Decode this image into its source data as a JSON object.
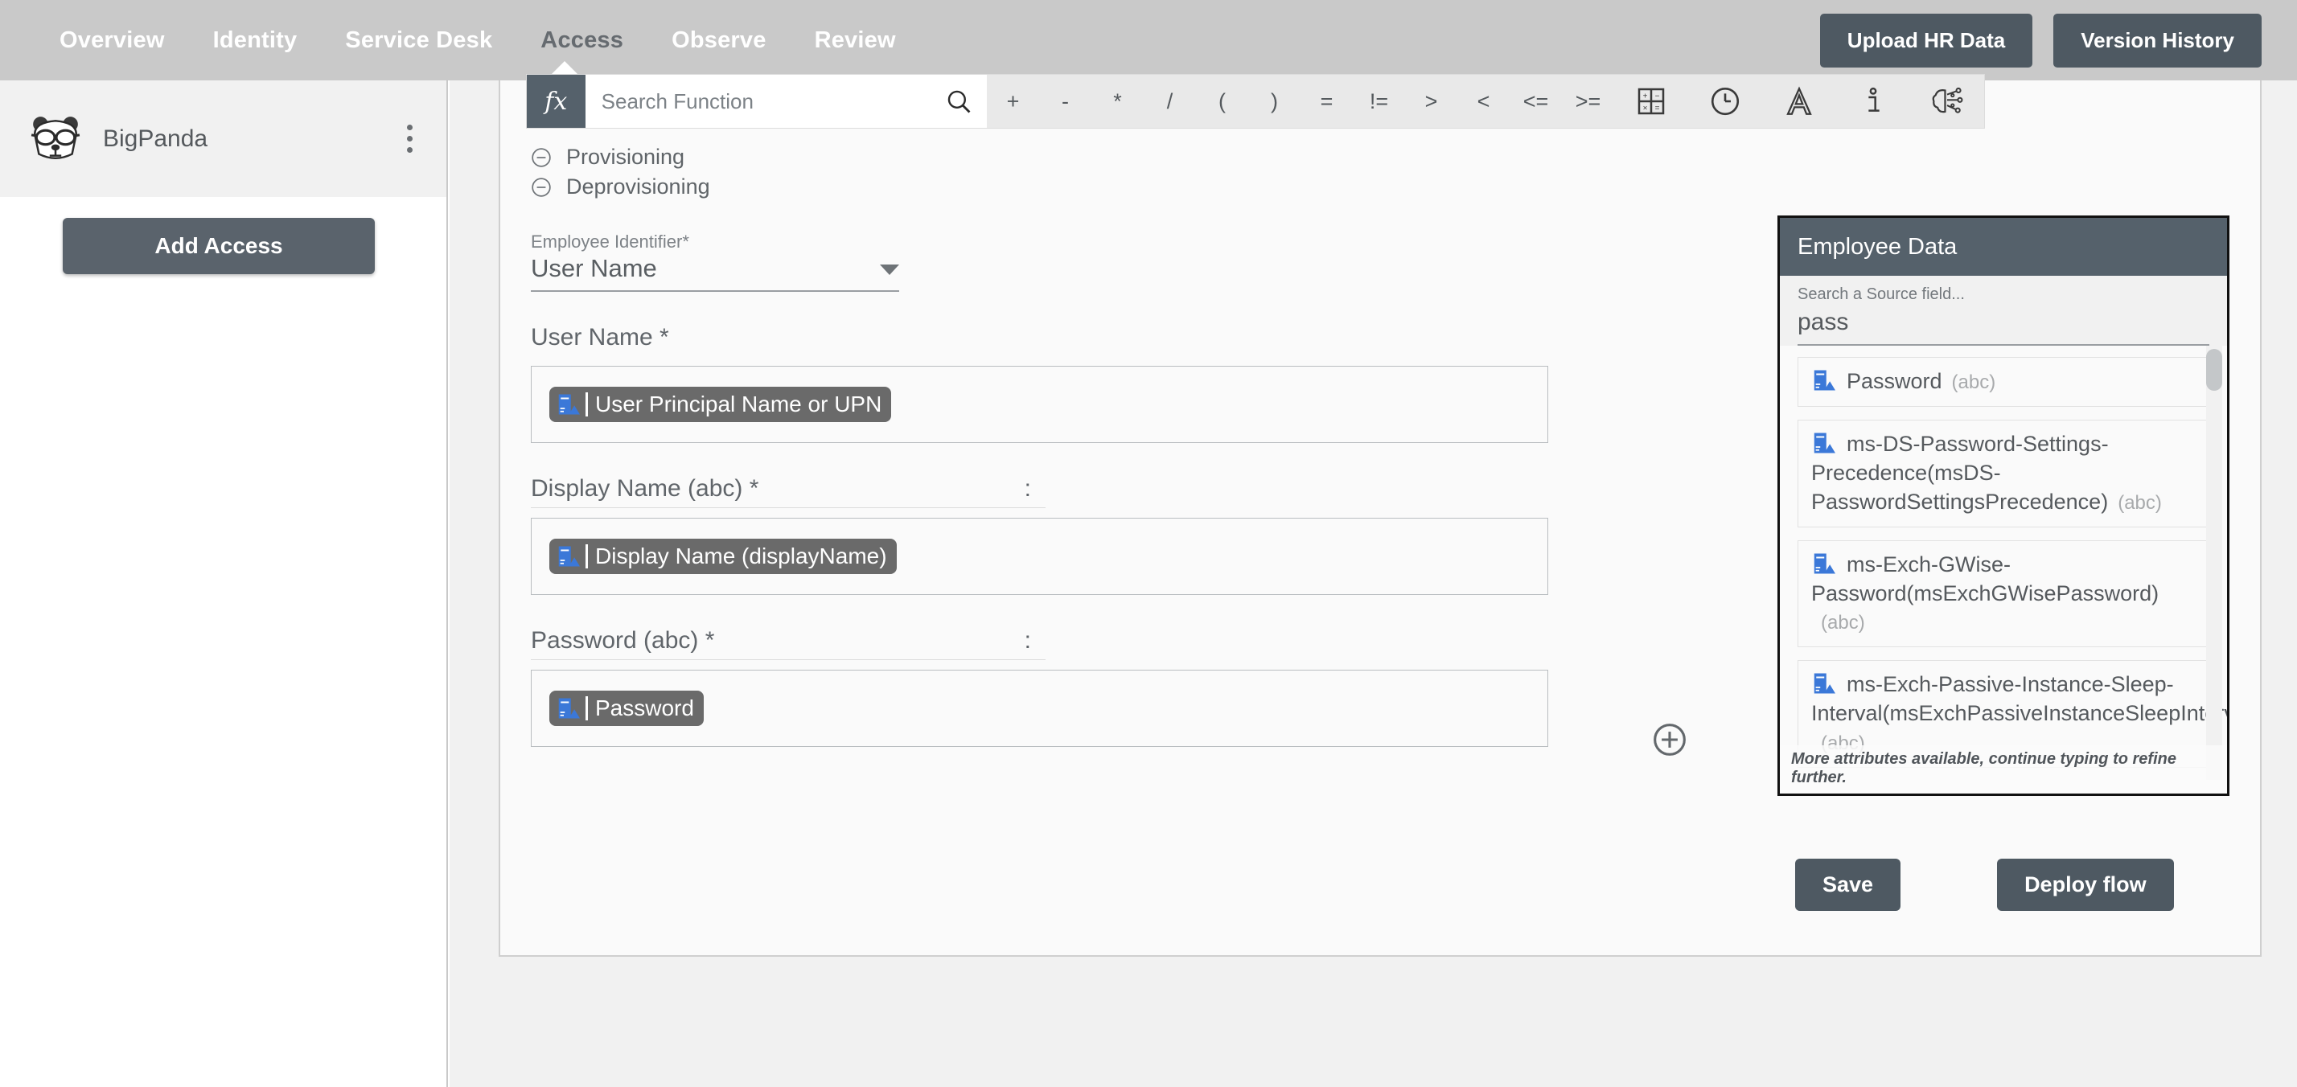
{
  "topnav": {
    "items": [
      {
        "label": "Overview",
        "active": false
      },
      {
        "label": "Identity",
        "active": false
      },
      {
        "label": "Service Desk",
        "active": false
      },
      {
        "label": "Access",
        "active": true
      },
      {
        "label": "Observe",
        "active": false
      },
      {
        "label": "Review",
        "active": false
      }
    ],
    "upload_hr_data": "Upload HR Data",
    "version_history": "Version History",
    "bg_color": "#c9c9c9",
    "button_color": "#4e5962"
  },
  "sidebar": {
    "org_name": "BigPanda",
    "logo_icon": "panda-logo-icon",
    "menu_icon": "kebab-menu-icon",
    "add_access": "Add Access"
  },
  "formula_bar": {
    "fx_label": "fx",
    "search_placeholder": "Search Function",
    "search_value": "",
    "search_icon": "search-icon",
    "operators": [
      "+",
      "-",
      "*",
      "/",
      "(",
      ")",
      "=",
      "!=",
      ">",
      "<",
      "<=",
      ">="
    ],
    "icons": [
      {
        "name": "calculator-icon",
        "title": "Math"
      },
      {
        "name": "clock-icon",
        "title": "Date & Time"
      },
      {
        "name": "text-a-icon",
        "title": "Text"
      },
      {
        "name": "info-icon",
        "title": "Info"
      },
      {
        "name": "ai-brain-icon",
        "title": "AI"
      }
    ]
  },
  "form": {
    "sections": [
      {
        "label": "Provisioning",
        "icon": "minus-circle-icon"
      },
      {
        "label": "Deprovisioning",
        "icon": "minus-circle-icon"
      }
    ],
    "employee_identifier": {
      "label": "Employee Identifier*",
      "value": "User Name",
      "caret_icon": "chevron-down-icon"
    },
    "fields": [
      {
        "label": "User Name *",
        "colon": "",
        "token": "User Principal Name or UPN",
        "token_icon": "source-field-icon"
      },
      {
        "label": "Display Name (abc) *",
        "colon": ":",
        "token": "Display Name (displayName)",
        "token_icon": "source-field-icon"
      },
      {
        "label": "Password (abc) *",
        "colon": ":",
        "token": "Password",
        "token_icon": "source-field-icon"
      }
    ],
    "add_field_icon": "plus-circle-icon"
  },
  "employee_data_panel": {
    "title": "Employee Data",
    "search_placeholder": "Search a Source field...",
    "search_value": "pass",
    "items": [
      {
        "label": "Password",
        "type": "(abc)",
        "icon": "source-field-icon"
      },
      {
        "label": "ms-DS-Password-Settings-Precedence(msDS-PasswordSettingsPrecedence)",
        "type": "(abc)",
        "icon": "source-field-icon"
      },
      {
        "label": "ms-Exch-GWise-Password(msExchGWisePassword)",
        "type": "(abc)",
        "icon": "source-field-icon"
      },
      {
        "label": "ms-Exch-Passive-Instance-Sleep-Interval(msExchPassiveInstanceSleepInterval)",
        "type": "(abc)",
        "icon": "source-field-icon"
      }
    ],
    "footer_note": "More attributes available, continue typing to refine further.",
    "header_color": "#55616b"
  },
  "footer": {
    "save": "Save",
    "deploy": "Deploy flow"
  }
}
